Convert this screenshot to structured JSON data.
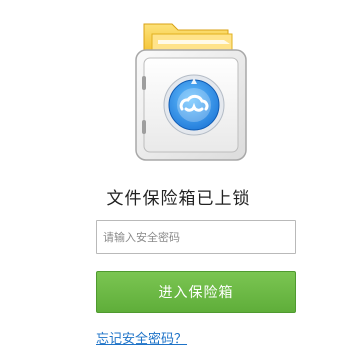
{
  "lock_screen": {
    "title": "文件保险箱已上锁",
    "password_placeholder": "请输入安全密码",
    "enter_button_label": "进入保险箱",
    "forgot_password_link": "忘记安全密码？"
  },
  "icons": {
    "illustration": "locked-safe-icon",
    "dial": "cloud-icon"
  },
  "colors": {
    "accent_blue": "#1e73c8",
    "button_green": "#6cb847",
    "folder_yellow": "#f4c430"
  }
}
